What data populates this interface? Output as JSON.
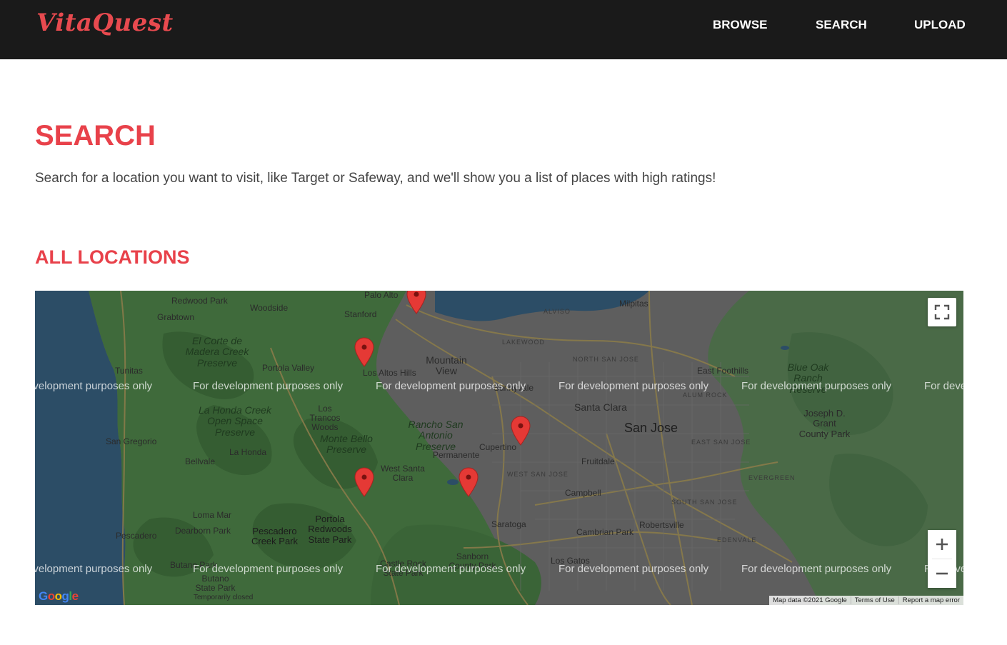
{
  "brand": {
    "name": "VitaQuest",
    "color": "#e84a4f"
  },
  "nav": {
    "items": [
      {
        "label": "BROWSE"
      },
      {
        "label": "SEARCH"
      },
      {
        "label": "UPLOAD"
      }
    ]
  },
  "page": {
    "title": "SEARCH",
    "intro": "Search for a location you want to visit, like Target or Safeway, and we'll show you a list of places with high ratings!",
    "accent": "#e8414a"
  },
  "locations": {
    "title": "ALL LOCATIONS",
    "map": {
      "watermark": "For development purposes only",
      "google_logo": "Google",
      "attribution": [
        "Map data ©2021 Google",
        "Terms of Use",
        "Report a map error"
      ],
      "controls": {
        "fullscreen_icon": "fullscreen-icon",
        "zoom_in": "+",
        "zoom_out": "−"
      },
      "marker_count": 5,
      "places": [
        {
          "name": "Palo Alto"
        },
        {
          "name": "Milpitas"
        },
        {
          "name": "Redwood Park"
        },
        {
          "name": "Woodside"
        },
        {
          "name": "Stanford"
        },
        {
          "name": "Grabtown"
        },
        {
          "name": "El Corte de Madera Creek Preserve"
        },
        {
          "name": "Portola Valley"
        },
        {
          "name": "Los Altos Hills"
        },
        {
          "name": "Mountain View"
        },
        {
          "name": "Sunnyvale"
        },
        {
          "name": "Tunitas"
        },
        {
          "name": "La Honda Creek Open Space Preserve"
        },
        {
          "name": "Los Trancos Woods"
        },
        {
          "name": "Santa Clara"
        },
        {
          "name": "San Jose"
        },
        {
          "name": "Rancho San Antonio Preserve"
        },
        {
          "name": "Monte Bello Preserve"
        },
        {
          "name": "Permanente"
        },
        {
          "name": "Cupertino"
        },
        {
          "name": "San Gregorio"
        },
        {
          "name": "La Honda"
        },
        {
          "name": "Bellvale"
        },
        {
          "name": "West Santa Clara"
        },
        {
          "name": "Fruitdale"
        },
        {
          "name": "Campbell"
        },
        {
          "name": "Loma Mar"
        },
        {
          "name": "Portola Redwoods State Park"
        },
        {
          "name": "Saratoga"
        },
        {
          "name": "Pescadero"
        },
        {
          "name": "Dearborn Park"
        },
        {
          "name": "Pescadero Creek Park"
        },
        {
          "name": "Cambrian Park"
        },
        {
          "name": "Robertsville"
        },
        {
          "name": "Blue Oak Ranch Reserve"
        },
        {
          "name": "East Foothills"
        },
        {
          "name": "Joseph D. Grant County Park"
        },
        {
          "name": "Sanborn County Park"
        },
        {
          "name": "Castle Rock State Park"
        },
        {
          "name": "Los Gatos"
        },
        {
          "name": "Butano Park"
        },
        {
          "name": "Butano State Park"
        },
        {
          "name": "Temporarily closed"
        },
        {
          "name": "ALVISO"
        },
        {
          "name": "LAKEWOOD"
        },
        {
          "name": "NORTH SAN JOSE"
        },
        {
          "name": "ALUM ROCK"
        },
        {
          "name": "EAST SAN JOSE"
        },
        {
          "name": "WEST SAN JOSE"
        },
        {
          "name": "EVERGREEN"
        },
        {
          "name": "SOUTH SAN JOSE"
        },
        {
          "name": "EDENVALE"
        }
      ]
    }
  },
  "colors": {
    "navbar": "#1a1a1a",
    "water": "#2c4d66",
    "forest": "#3e6b3a",
    "urban": "#5e5e5e",
    "marker": "#e53935"
  }
}
